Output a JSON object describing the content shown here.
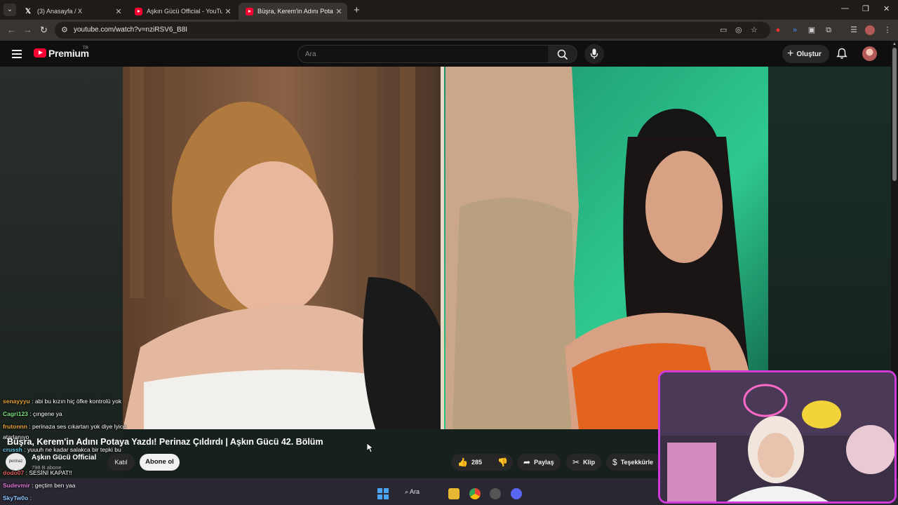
{
  "browser": {
    "tabs": [
      {
        "title": "(3) Anasayfa / X",
        "icon": "x-logo-icon"
      },
      {
        "title": "Aşkın Gücü Official - YouTube",
        "icon": "youtube-icon"
      },
      {
        "title": "Büşra, Kerem'in Adını Potaya Yazdı",
        "icon": "youtube-icon",
        "active": true
      }
    ],
    "url": "youtube.com/watch?v=nziRSV6_B8I"
  },
  "youtube": {
    "brand": "Premium",
    "region": "TR",
    "search_placeholder": "Ara",
    "create_label": "Oluştur"
  },
  "video": {
    "title": "Büşra, Kerem'in Adını Potaya Yazdı! Perinaz Çıldırdı | Aşkın Gücü 42. Bölüm",
    "channel": "Aşkın Gücü Official",
    "subscribers": "798 B abone",
    "join_label": "Katıl",
    "subscribe_label": "Abone ol",
    "likes": "285",
    "share_label": "Paylaş",
    "clip_label": "Klip",
    "thanks_label": "Teşekkürle",
    "channel_avatar_text": "perinaz"
  },
  "chat": [
    {
      "user": "senayyyu",
      "color": "#e8a33a",
      "text": ": abi bu kızın hiç öfke kontrolü yok"
    },
    {
      "user": "Cagri123",
      "color": "#7fe07f",
      "text": ": çıngene ya"
    },
    {
      "user": "frutonnn",
      "color": "#e8a33a",
      "text": ": perinaza ses cıkartan yok diye lyice"
    },
    {
      "user": "",
      "color": "#ffffff",
      "text": "atarlanıyo"
    },
    {
      "user": "crussh",
      "color": "#5ec7e8",
      "text": ": yuuuh ne kadar salakca bir tepki bu"
    },
    {
      "user": "dodo07",
      "color": "#e05a5a",
      "text": ": SESİNİ KAPAT!!"
    },
    {
      "user": "Sudevmir",
      "color": "#e07ad8",
      "text": ": geçtim ben yaa"
    },
    {
      "user": "SkyTw0o",
      "color": "#8cc8ff",
      "text": ":"
    }
  ],
  "taskbar": {
    "search_label": "Ara"
  },
  "colors": {
    "accent": "#ff0033",
    "cam_border": "#cf3ad8"
  }
}
